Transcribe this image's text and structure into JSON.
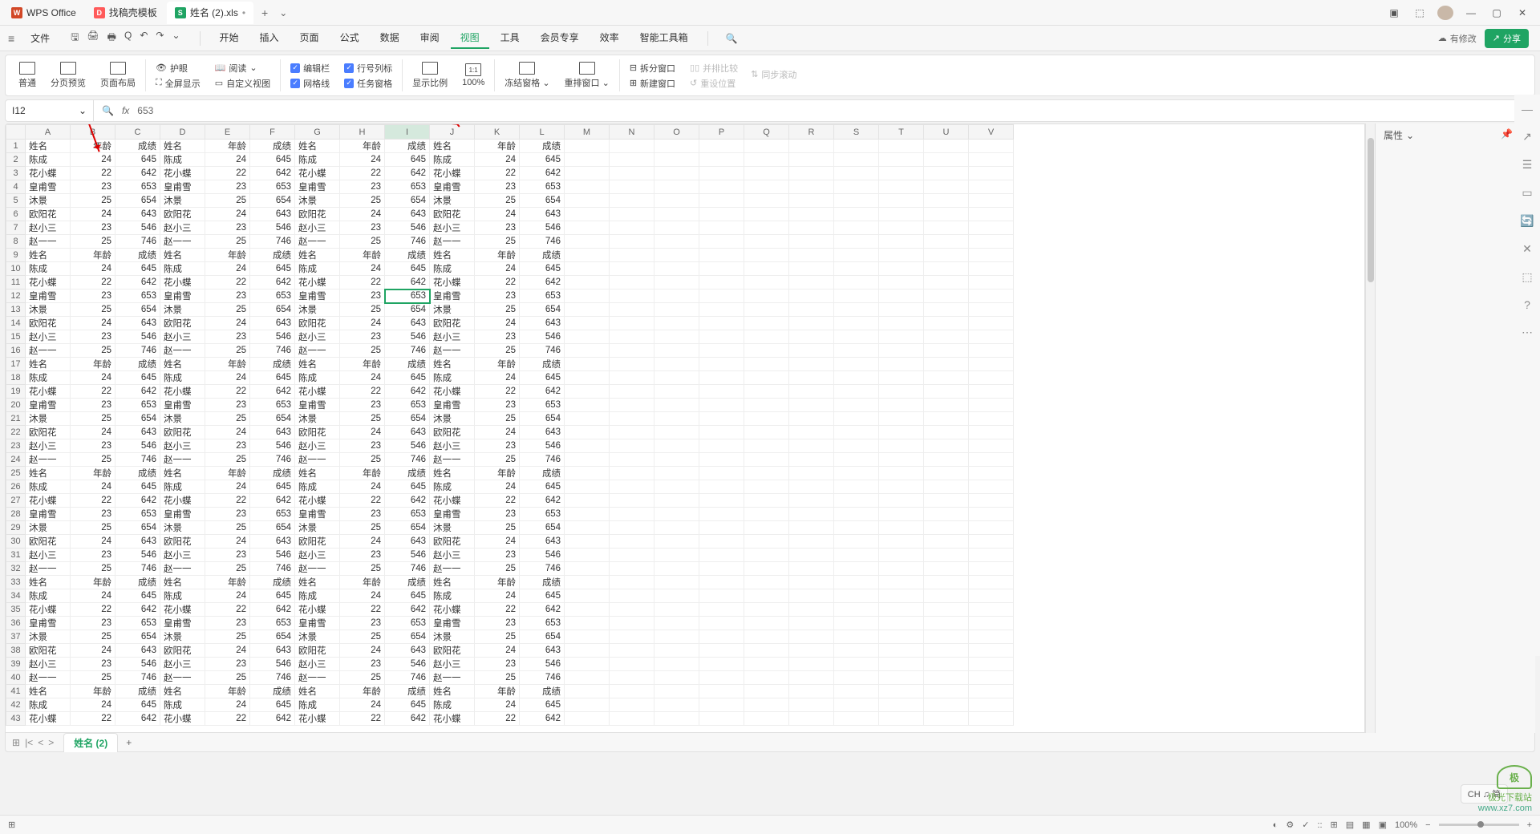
{
  "tabs": {
    "items": [
      {
        "icon": "W",
        "icon_class": "wps-ico",
        "label": "WPS Office"
      },
      {
        "icon": "D",
        "icon_class": "d-ico",
        "label": "找稿壳模板"
      },
      {
        "icon": "S",
        "icon_class": "s-ico",
        "label": "姓名 (2).xls"
      }
    ],
    "dirty_marker": "•",
    "add": "+",
    "dropdown": "⌄"
  },
  "window_controls": {
    "min": "—",
    "max": "▢",
    "close": "✕",
    "box": "▣",
    "cube": "⬚"
  },
  "menu": {
    "hamburger": "≡",
    "file": "文件",
    "qat": [
      "🖫",
      "🖨",
      "🖶",
      "Q",
      "↶",
      "↷",
      "⌄"
    ],
    "ribbon_tabs": [
      "开始",
      "插入",
      "页面",
      "公式",
      "数据",
      "审阅",
      "视图",
      "工具",
      "会员专享",
      "效率",
      "智能工具箱"
    ],
    "active_tab_index": 6,
    "search_icon": "🔍",
    "modified": "有修改",
    "share": "分享"
  },
  "ribbon": {
    "views": [
      {
        "label": "普通",
        "name": "view-normal"
      },
      {
        "label": "分页预览",
        "name": "view-page-break"
      },
      {
        "label": "页面布局",
        "name": "view-page-layout"
      }
    ],
    "options1": [
      {
        "icon": "👁",
        "label": "护眼"
      },
      {
        "icon": "⛶",
        "label": "全屏显示"
      }
    ],
    "options2": [
      {
        "icon": "📖",
        "label": "阅读",
        "drop": "⌄"
      },
      {
        "icon": "▭",
        "label": "自定义视图"
      }
    ],
    "checks": [
      {
        "label": "编辑栏",
        "on": true
      },
      {
        "label": "行号列标",
        "on": true
      },
      {
        "label": "网格线",
        "on": true
      },
      {
        "label": "任务窗格",
        "on": true
      }
    ],
    "scale": {
      "label": "显示比例",
      "pct": "100%"
    },
    "freeze": {
      "label": "冻结窗格",
      "drop": "⌄"
    },
    "arrange": {
      "label": "重排窗口",
      "drop": "⌄"
    },
    "split": {
      "label": "拆分窗口"
    },
    "new": {
      "label": "新建窗口"
    },
    "sync": {
      "label": "同步滚动"
    },
    "compare": {
      "label": "并排比较"
    },
    "reset": {
      "label": "重设位置"
    }
  },
  "name_box": {
    "cell": "I12",
    "fx": "fx",
    "formula": "653",
    "search": "🔍"
  },
  "columns": [
    "A",
    "B",
    "C",
    "D",
    "E",
    "F",
    "G",
    "H",
    "I",
    "J",
    "K",
    "L",
    "M",
    "N",
    "O",
    "P",
    "Q",
    "R",
    "S",
    "T",
    "U",
    "V"
  ],
  "selected_col": "I",
  "selected_row": 12,
  "chart_data": {
    "type": "table",
    "headers": [
      "姓名",
      "年龄",
      "成绩"
    ],
    "block": [
      [
        "陈成",
        24,
        645
      ],
      [
        "花小蝶",
        22,
        642
      ],
      [
        "皇甫雪",
        23,
        653
      ],
      [
        "沐景",
        25,
        654
      ],
      [
        "欧阳花",
        24,
        643
      ],
      [
        "赵小三",
        23,
        546
      ],
      [
        "赵一一",
        25,
        746
      ]
    ],
    "repeat_rows": 6,
    "repeat_cols": 4,
    "partial_last": 3
  },
  "right_panel": {
    "title": "属性",
    "drop": "⌄",
    "pin": "📌",
    "close": "✕"
  },
  "side_rail": [
    "—",
    "↗",
    "☰",
    "▭",
    "🔄",
    "✕",
    "⬚",
    "?",
    "⋯"
  ],
  "sheet_tabs": {
    "nav": [
      "⊞",
      "|<",
      "<",
      ">"
    ],
    "active": "姓名 (2)",
    "add": "+"
  },
  "status_bar": {
    "left": "⊞",
    "views": [
      "⊞",
      "▤",
      "▦",
      "▣"
    ],
    "zoom": "100%",
    "minus": "−",
    "plus": "+",
    "tools": [
      "◐",
      "⚙",
      "✓",
      "::"
    ]
  },
  "ime": "CH ♫ 简",
  "watermark": {
    "logo": "极",
    "site": "极光下载站",
    "url": "www.xz7.com"
  }
}
